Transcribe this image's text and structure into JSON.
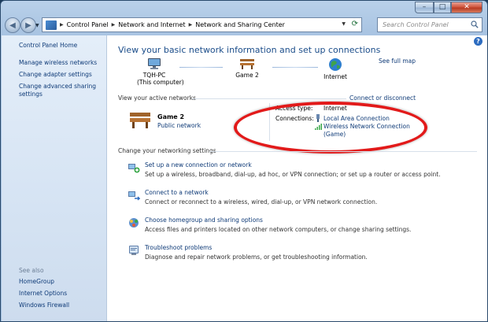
{
  "window": {
    "controls": {
      "minimize": "–",
      "maximize": "□",
      "close": "✕"
    }
  },
  "address_bar": {
    "breadcrumbs": [
      "Control Panel",
      "Network and Internet",
      "Network and Sharing Center"
    ],
    "search_placeholder": "Search Control Panel"
  },
  "sidebar": {
    "home": "Control Panel Home",
    "links": [
      "Manage wireless networks",
      "Change adapter settings",
      "Change advanced sharing settings"
    ],
    "see_also_heading": "See also",
    "see_also": [
      "HomeGroup",
      "Internet Options",
      "Windows Firewall"
    ]
  },
  "main": {
    "title": "View your basic network information and set up connections",
    "see_full_map": "See full map",
    "map": {
      "computer_name": "TQH-PC",
      "computer_sub": "(This computer)",
      "network_name": "Game 2",
      "internet_label": "Internet"
    },
    "active_networks": {
      "heading": "View your active networks",
      "connect_disconnect": "Connect or disconnect",
      "network_name": "Game 2",
      "network_type": "Public network",
      "access_type_label": "Access type:",
      "access_type_value": "Internet",
      "connections_label": "Connections:",
      "connection_1": "Local Area Connection",
      "connection_2_line1": "Wireless Network Connection",
      "connection_2_line2": "(Game)"
    },
    "settings": {
      "heading": "Change your networking settings",
      "tasks": [
        {
          "link": "Set up a new connection or network",
          "desc": "Set up a wireless, broadband, dial-up, ad hoc, or VPN connection; or set up a router or access point."
        },
        {
          "link": "Connect to a network",
          "desc": "Connect or reconnect to a wireless, wired, dial-up, or VPN network connection."
        },
        {
          "link": "Choose homegroup and sharing options",
          "desc": "Access files and printers located on other network computers, or change sharing settings."
        },
        {
          "link": "Troubleshoot problems",
          "desc": "Diagnose and repair network problems, or get troubleshooting information."
        }
      ]
    }
  },
  "colors": {
    "link": "#0e3a77",
    "title": "#1b4d8a",
    "highlight": "#e21a1a"
  }
}
